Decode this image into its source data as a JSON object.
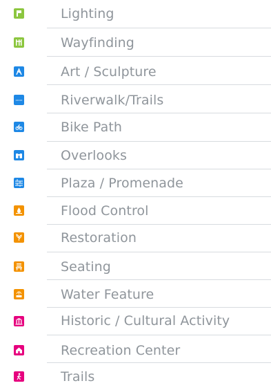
{
  "legend": {
    "items": [
      {
        "label": "Lighting",
        "icon": "lighting-icon",
        "color": "#8cc63f"
      },
      {
        "label": "Wayfinding",
        "icon": "wayfinding-icon",
        "color": "#8cc63f"
      },
      {
        "label": "Art / Sculpture",
        "icon": "art-sculpture-icon",
        "color": "#1e88e5"
      },
      {
        "label": "Riverwalk/Trails",
        "icon": "riverwalk-icon",
        "color": "#1e88e5"
      },
      {
        "label": "Bike Path",
        "icon": "bike-icon",
        "color": "#1e88e5"
      },
      {
        "label": "Overlooks",
        "icon": "binoculars-icon",
        "color": "#1e88e5"
      },
      {
        "label": "Plaza / Promenade",
        "icon": "plaza-icon",
        "color": "#1e88e5"
      },
      {
        "label": "Flood Control",
        "icon": "flood-control-icon",
        "color": "#f39200"
      },
      {
        "label": "Restoration",
        "icon": "restoration-icon",
        "color": "#f39200"
      },
      {
        "label": "Seating",
        "icon": "seating-icon",
        "color": "#f39200"
      },
      {
        "label": "Water Feature",
        "icon": "water-feature-icon",
        "color": "#f39200"
      },
      {
        "label": "Historic / Cultural Activity",
        "icon": "historic-icon",
        "color": "#e6007e"
      },
      {
        "label": "Recreation Center",
        "icon": "recreation-center-icon",
        "color": "#e6007e"
      },
      {
        "label": "Trails",
        "icon": "hiker-icon",
        "color": "#e6007e"
      }
    ]
  }
}
